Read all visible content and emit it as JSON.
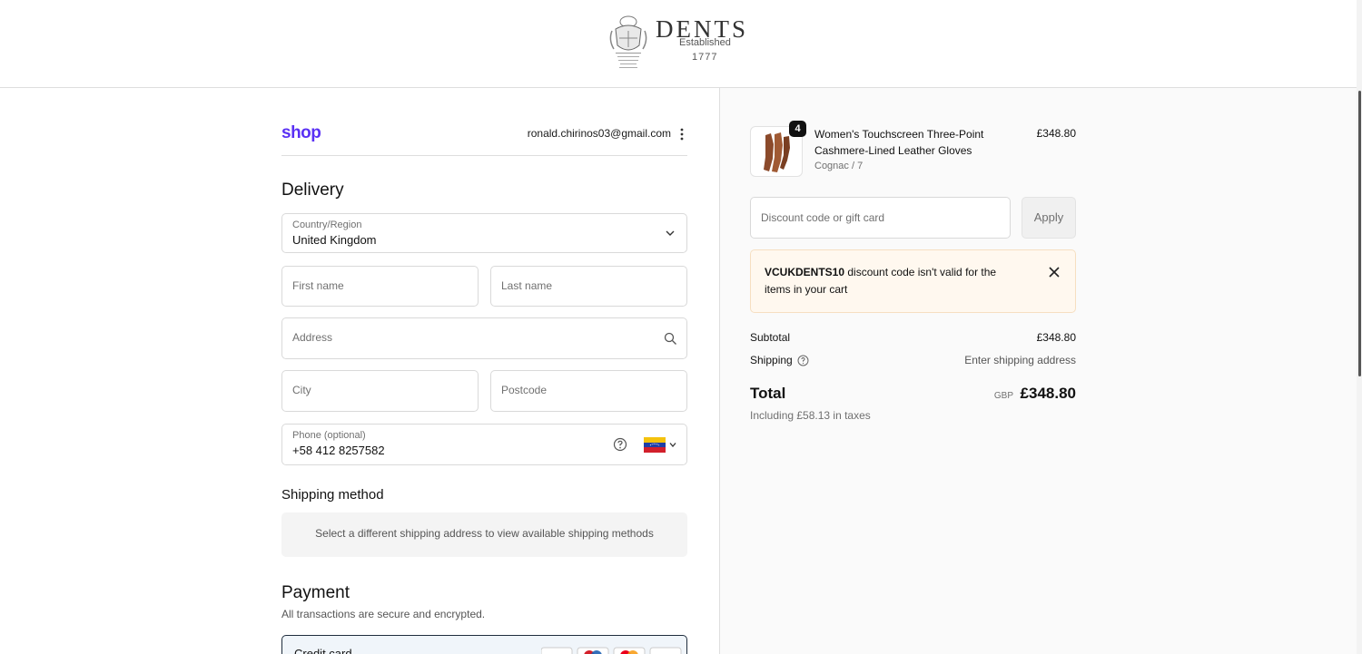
{
  "header": {
    "brand_name": "DENTS",
    "brand_tagline": "Established",
    "brand_year": "1777"
  },
  "account": {
    "shop_logo": "shop",
    "email": "ronald.chirinos03@gmail.com"
  },
  "delivery": {
    "title": "Delivery",
    "country_label": "Country/Region",
    "country_value": "United Kingdom",
    "first_name_placeholder": "First name",
    "last_name_placeholder": "Last name",
    "address_placeholder": "Address",
    "city_placeholder": "City",
    "postcode_placeholder": "Postcode",
    "phone_label": "Phone (optional)",
    "phone_value": "+58 412 8257582"
  },
  "shipping": {
    "title": "Shipping method",
    "notice": "Select a different shipping address to view available shipping methods"
  },
  "payment": {
    "title": "Payment",
    "subtitle": "All transactions are secure and encrypted.",
    "method_label": "Credit card"
  },
  "cart": {
    "quantity": "4",
    "product_name": "Women's Touchscreen Three-Point Cashmere-Lined Leather Gloves",
    "variant": "Cognac / 7",
    "price": "£348.80"
  },
  "discount": {
    "placeholder": "Discount code or gift card",
    "apply_label": "Apply",
    "alert_code": "VCUKDENTS10",
    "alert_message": " discount code isn't valid for the items in your cart"
  },
  "summary": {
    "subtotal_label": "Subtotal",
    "subtotal_value": "£348.80",
    "shipping_label": "Shipping",
    "shipping_value": "Enter shipping address",
    "total_label": "Total",
    "total_currency": "GBP",
    "total_value": "£348.80",
    "tax_note": "Including £58.13 in taxes"
  },
  "colors": {
    "shop_brand": "#5a31f4",
    "alert_bg": "#fff8ef",
    "alert_border": "#f6dfc1",
    "glove": "#8b4a2b"
  }
}
